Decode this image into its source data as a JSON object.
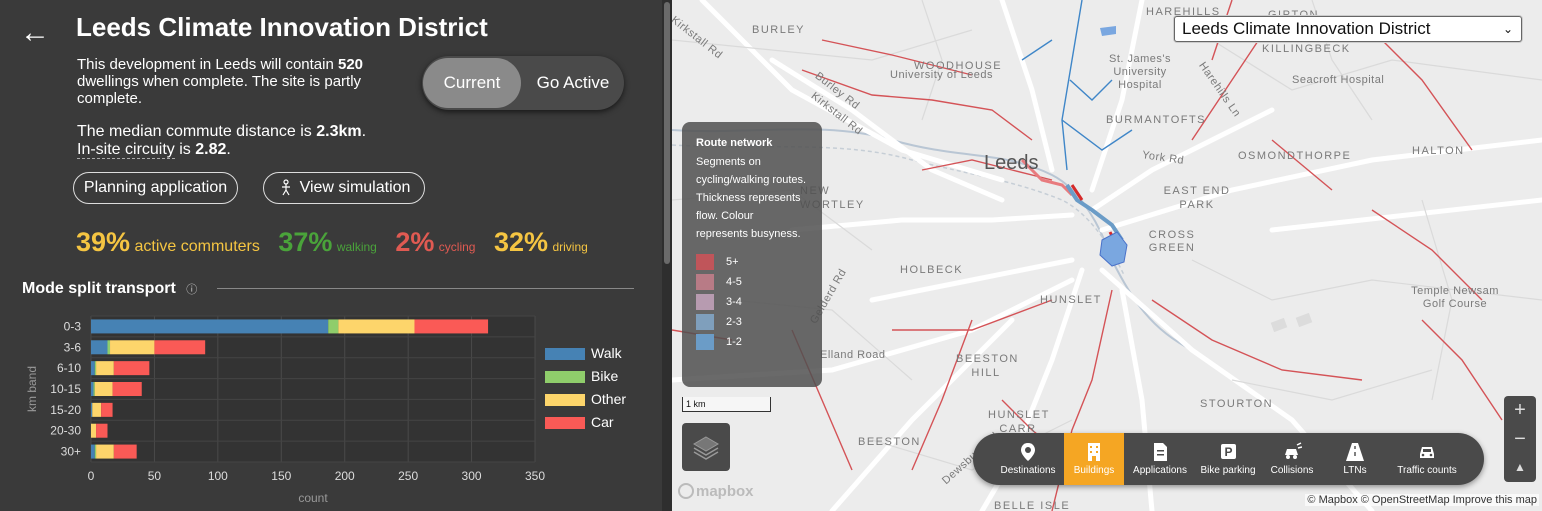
{
  "panel": {
    "back_glyph": "←",
    "title": "Leeds Climate Innovation District",
    "desc_pre": "This development in Leeds will contain ",
    "desc_count": "520",
    "desc_post": " dwellings when complete. The site is partly complete.",
    "commute_pre": "The median commute distance is ",
    "commute_value": "2.3km",
    "commute_post": ".",
    "circuity_label": "In-site circuity",
    "circuity_mid": " is ",
    "circuity_value": "2.82",
    "circuity_post": ".",
    "toggle": {
      "current": "Current",
      "go_active": "Go Active"
    },
    "planning_button": "Planning application",
    "simulation_button": "View simulation",
    "stats": [
      {
        "value": "39%",
        "label": "active commuters",
        "color": "#f5c542"
      },
      {
        "value": "37%",
        "label": "walking",
        "color": "#4aa33a"
      },
      {
        "value": "2%",
        "label": "cycling",
        "color": "#e05a52"
      },
      {
        "value": "32%",
        "label": "driving",
        "color": "#f5c542"
      }
    ],
    "section_title": "Mode split transport",
    "info_icon": "ⓘ"
  },
  "chart_data": {
    "type": "bar",
    "orientation": "horizontal",
    "stacked": true,
    "categories": [
      "0-3",
      "3-6",
      "6-10",
      "10-15",
      "15-20",
      "20-30",
      "30+"
    ],
    "series": [
      {
        "name": "Walk",
        "color": "#4682b4",
        "values": [
          187,
          13,
          3,
          2,
          1,
          0,
          3
        ]
      },
      {
        "name": "Bike",
        "color": "#8fcd6b",
        "values": [
          8,
          2,
          1,
          1,
          0,
          0,
          1
        ]
      },
      {
        "name": "Other",
        "color": "#fdd56b",
        "values": [
          60,
          35,
          14,
          14,
          7,
          4,
          14
        ]
      },
      {
        "name": "Car",
        "color": "#fa5a56",
        "values": [
          58,
          40,
          28,
          23,
          9,
          9,
          18
        ]
      }
    ],
    "xlabel": "count",
    "ylabel": "km band",
    "xlim": [
      0,
      350
    ],
    "xticks": [
      0,
      50,
      100,
      150,
      200,
      250,
      300,
      350
    ],
    "grid": true,
    "legend": "right"
  },
  "map": {
    "select_value": "Leeds Climate Innovation District",
    "city_label": "Leeds",
    "place_labels": [
      "HAREHILLS",
      "GIPTON",
      "BURLEY",
      "WOODHOUSE",
      "St. James's University Hospital",
      "KILLINGBECK",
      "Seacroft Hospital",
      "University of Leeds",
      "BURMANTOFTS",
      "OSMONDTHORPE",
      "HALTON",
      "EAST END PARK",
      "CROSS GREEN",
      "NEW WORTLEY",
      "HOLBECK",
      "HUNSLET",
      "Elland Road",
      "BEESTON HILL",
      "Temple Newsam Golf Course",
      "STOURTON",
      "HUNSLET CARR",
      "BEESTON",
      "BELLE ISLE"
    ],
    "road_labels": [
      "Kirkstall Rd",
      "Burley Rd",
      "Kirkstall Rd",
      "York Rd",
      "Harehills Ln",
      "Dewsbury Rd",
      "Gelderd Rd"
    ],
    "legend": {
      "title": "Route network",
      "description": "Segments on cycling/walking routes. Thickness represents flow. Colour represents busyness.",
      "rows": [
        {
          "label": "5+",
          "color": "#c0555a"
        },
        {
          "label": "4-5",
          "color": "#b87b86"
        },
        {
          "label": "3-4",
          "color": "#b79bb0"
        },
        {
          "label": "2-3",
          "color": "#7f9fbc"
        },
        {
          "label": "1-2",
          "color": "#6b9cc7"
        }
      ]
    },
    "scale": "1 km",
    "toolbar": [
      {
        "label": "Destinations",
        "icon": "map-pin-icon"
      },
      {
        "label": "Buildings",
        "icon": "building-icon",
        "active": true
      },
      {
        "label": "Applications",
        "icon": "document-icon"
      },
      {
        "label": "Bike parking",
        "icon": "parking-icon"
      },
      {
        "label": "Collisions",
        "icon": "car-crash-icon"
      },
      {
        "label": "LTNs",
        "icon": "road-icon"
      },
      {
        "label": "Traffic counts",
        "icon": "car-icon"
      }
    ],
    "zoom_in": "+",
    "zoom_out": "−",
    "compass": "▲",
    "logo": "mapbox",
    "attribution": "© Mapbox © OpenStreetMap Improve this map"
  }
}
